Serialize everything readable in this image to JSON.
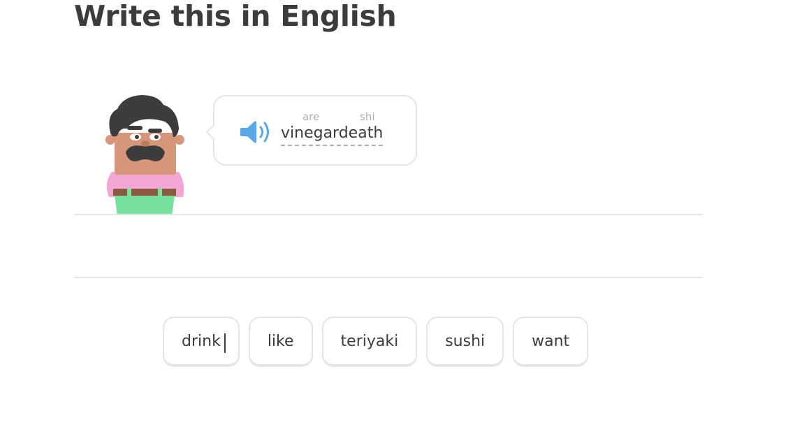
{
  "prompt": {
    "title": "Write this in English"
  },
  "speech": {
    "speaker_icon": "speaker-icon",
    "hints": [
      "are",
      "shi"
    ],
    "phrase": "vinegardeath"
  },
  "word_bank": {
    "tiles": [
      "drink",
      "like",
      "teriyaki",
      "sushi",
      "want"
    ]
  },
  "colors": {
    "accent": "#1cb0f6",
    "speaker": "#58a7e6",
    "border": "#e5e5e5",
    "text": "#3c3c3c",
    "hint": "#afafaf",
    "shirt": "#f2a6d3",
    "pants": "#77e29e",
    "skin": "#d6967a",
    "hair": "#3c3c3c"
  }
}
